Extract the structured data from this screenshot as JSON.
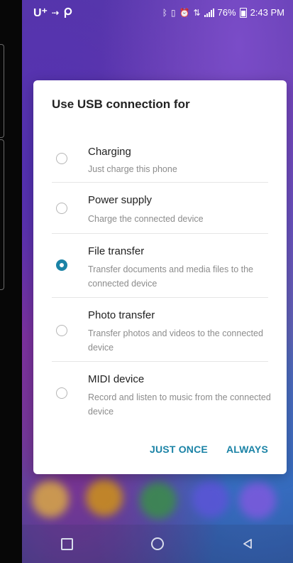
{
  "status_bar": {
    "carrier": "U⁺",
    "time": "2:43 PM",
    "battery_percent": "76%"
  },
  "dialog": {
    "title": "Use USB connection for",
    "options": [
      {
        "title": "Charging",
        "description": "Just charge this phone",
        "selected": false
      },
      {
        "title": "Power supply",
        "description": "Charge the connected device",
        "selected": false
      },
      {
        "title": "File transfer",
        "description": "Transfer documents and media files to the connected device",
        "selected": true
      },
      {
        "title": "Photo transfer",
        "description": "Transfer photos and videos to the connected device",
        "selected": false
      },
      {
        "title": "MIDI device",
        "description": "Record and listen to music from the connected device",
        "selected": false
      }
    ],
    "buttons": {
      "just_once": "JUST ONCE",
      "always": "ALWAYS"
    }
  },
  "colors": {
    "accent": "#1b83a6",
    "dialog_bg": "#ffffff"
  },
  "icons": {
    "navbar": [
      "recent-apps-icon",
      "home-icon",
      "back-icon"
    ]
  }
}
